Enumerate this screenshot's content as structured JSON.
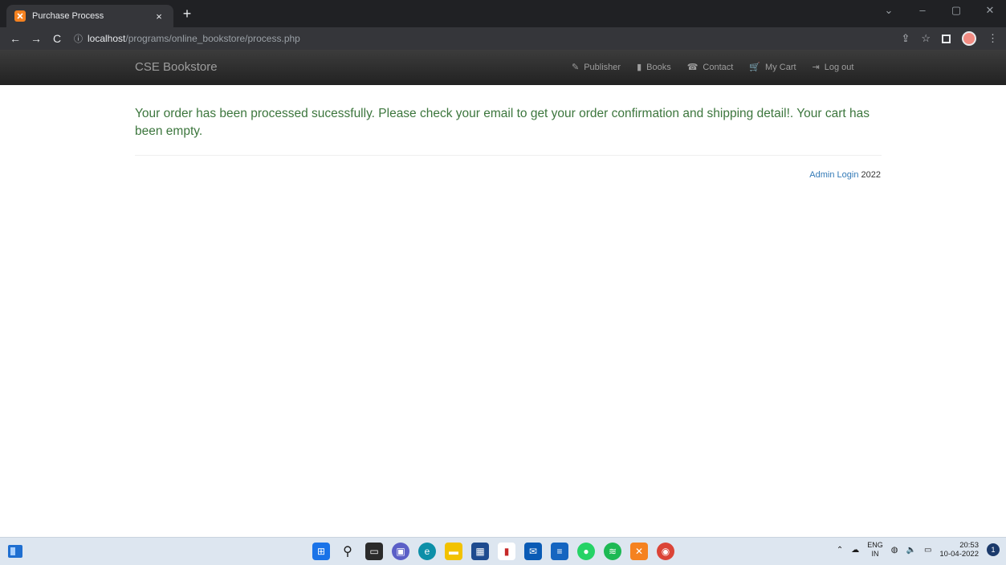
{
  "browser": {
    "tab_title": "Purchase Process",
    "tab_close": "×",
    "new_tab": "+",
    "url_host": "localhost",
    "url_path": "/programs/online_bookstore/process.php",
    "win_minimize": "–",
    "win_maximize": "▢",
    "win_close": "✕",
    "win_dropdown": "⌄"
  },
  "navbar": {
    "brand": "CSE Bookstore",
    "links": [
      {
        "label": "Publisher",
        "icon": "paperclip-icon",
        "glyph": "✎"
      },
      {
        "label": "Books",
        "icon": "book-icon",
        "glyph": "▮"
      },
      {
        "label": "Contact",
        "icon": "phone-icon",
        "glyph": "☎"
      },
      {
        "label": "My Cart",
        "icon": "cart-icon",
        "glyph": "🛒"
      },
      {
        "label": "Log out",
        "icon": "logout-icon",
        "glyph": "⇥"
      }
    ]
  },
  "main": {
    "message": "Your order has been processed sucessfully. Please check your email to get your order confirmation and shipping detail!. Your cart has been empty."
  },
  "footer": {
    "admin_link": "Admin Login",
    "year": "2022"
  },
  "taskbar": {
    "lang_top": "ENG",
    "lang_bottom": "IN",
    "time": "20:53",
    "date": "10-04-2022",
    "notification_count": "1"
  }
}
